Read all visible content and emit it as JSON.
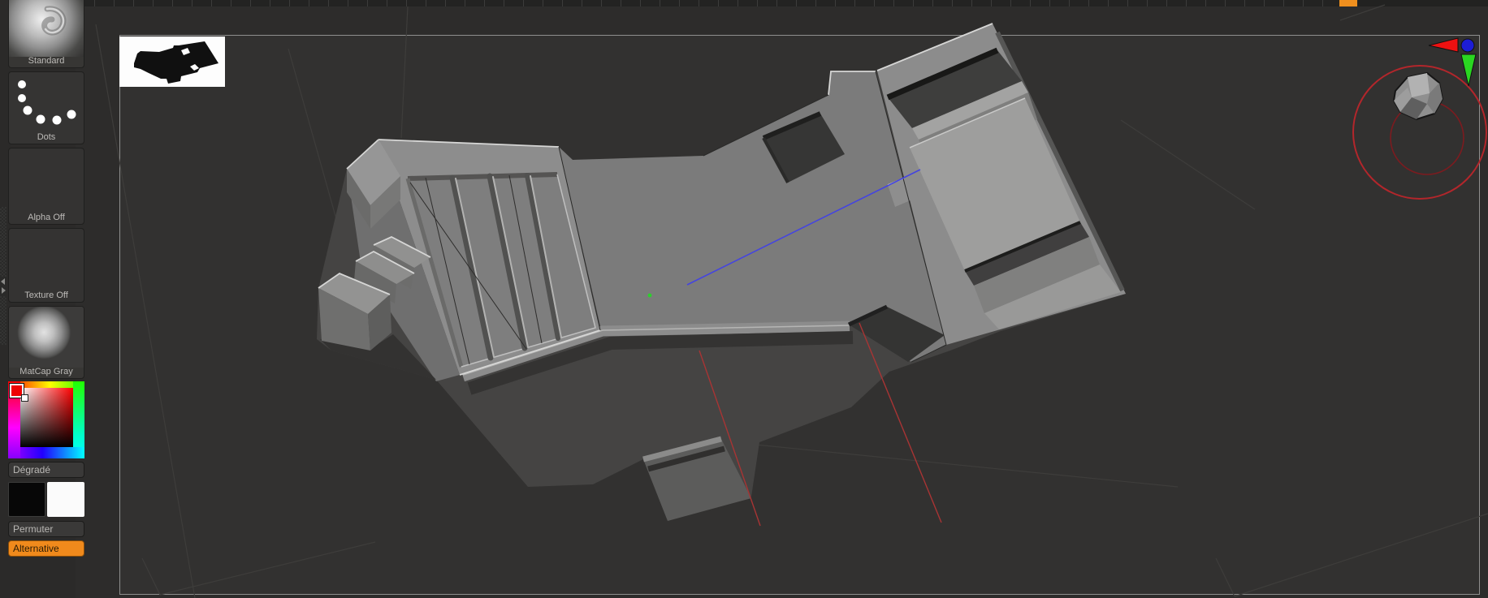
{
  "app": {
    "name_hint": "sculpting-app-viewport",
    "accent_color": "#ef8f1e",
    "background_color": "#2b2a29",
    "canvas_color": "#323130",
    "canvas_frame_color": "#8e8e8d"
  },
  "timeline": {
    "active_segment_color": "#ef8f1e"
  },
  "tool_tray": {
    "brush": {
      "label": "Standard",
      "icon": "clay-swirl-sphere"
    },
    "stroke": {
      "label": "Dots",
      "icon": "dots-arc"
    },
    "alpha": {
      "label": "Alpha Off"
    },
    "texture": {
      "label": "Texture Off"
    },
    "material": {
      "label": "MatCap Gray",
      "icon": "gray-sphere"
    },
    "color_picker": {
      "gradient_label": "Dégradé",
      "selected_color": "#ee0404",
      "icon": "hue-square-picker"
    },
    "swap_label": "Permuter",
    "alternative_label": "Alternative",
    "alternative_color": "#f08a1c",
    "main_secondary_swatches": [
      "#070707",
      "#fbfbfb"
    ]
  },
  "viewport": {
    "document_thumbnail": {
      "bg": "#fdfdfd",
      "silhouette_color": "#111111"
    },
    "model": {
      "kind": "hard-surface gray mech block",
      "matcap": "gray"
    },
    "axis_lines": {
      "z_axis_color": "#4444e0",
      "x_axis_color": "#a83434",
      "grid_center_color": "#2bd12b"
    },
    "nav_gizmo": {
      "outer_ring_color": "#b3262b",
      "inner_ring_color": "#7c1b1f",
      "axis_markers": [
        {
          "name": "x",
          "shape": "triangle-left",
          "color": "#ee1111"
        },
        {
          "name": "z",
          "shape": "circle",
          "color": "#1d1dd6"
        },
        {
          "name": "y",
          "shape": "triangle-down",
          "color": "#2ad621"
        }
      ]
    }
  }
}
